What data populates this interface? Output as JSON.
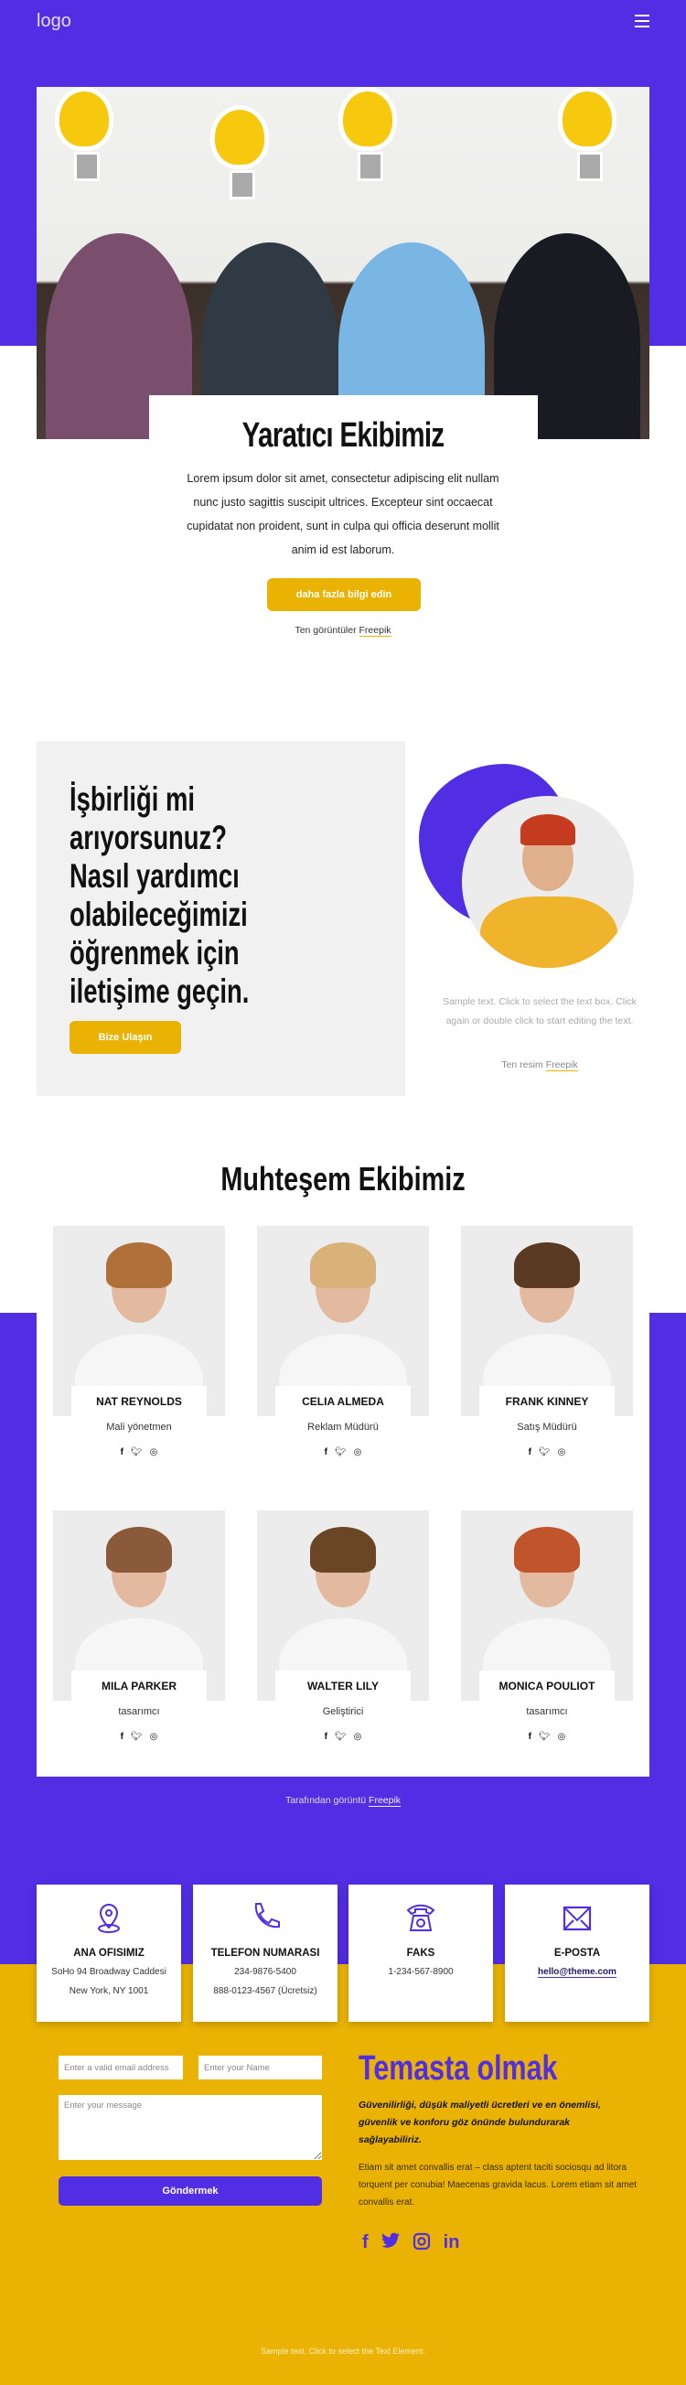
{
  "header": {
    "logo": "logo",
    "menu_icon": "hamburger-icon"
  },
  "hero": {
    "title": "Yaratıcı Ekibimiz",
    "text": "Lorem ipsum dolor sit amet, consectetur adipiscing elit nullam nunc justo sagittis suscipit ultrices. Excepteur sint occaecat cupidatat non proident, sunt in culpa qui officia deserunt mollit anim id est laborum.",
    "button": "daha fazla bilgi edin",
    "credit_prefix": "Ten görüntüler",
    "credit_link": "Freepik"
  },
  "collab": {
    "title": "İşbirliği mi\narıyorsunuz?\nNasıl yardımcı\nolabileceğimizi\nöğrenmek için\niletişime geçin.",
    "button": "Bize Ulaşın",
    "sample": "Sample text. Click to select the text box. Click again or double click to start editing the text.",
    "credit_prefix": "Ten resim",
    "credit_link": "Freepik"
  },
  "team": {
    "title": "Muhteşem Ekibimiz",
    "members": [
      {
        "name": "NAT REYNOLDS",
        "role": "Mali yönetmen"
      },
      {
        "name": "CELIA ALMEDA",
        "role": "Reklam Müdürü"
      },
      {
        "name": "FRANK KINNEY",
        "role": "Satış Müdürü"
      },
      {
        "name": "MILA PARKER",
        "role": "tasarımcı"
      },
      {
        "name": "WALTER LILY",
        "role": "Geliştirici"
      },
      {
        "name": "MONICA POULIOT",
        "role": "tasarımcı"
      }
    ],
    "social": [
      "f",
      "𝕥",
      "◎"
    ],
    "credit_prefix": "Tarafından görüntü",
    "credit_link": "Freepik"
  },
  "contact_info": [
    {
      "icon": "map-pin-icon",
      "title": "ANA OFISIMIZ",
      "lines": [
        "SoHo 94 Broadway Caddesi",
        "New York, NY 1001"
      ]
    },
    {
      "icon": "phone-icon",
      "title": "TELEFON NUMARASI",
      "lines": [
        "234-9876-5400",
        "888-0123-4567 (Ücretsiz)"
      ]
    },
    {
      "icon": "telephone-icon",
      "title": "FAKS",
      "lines": [
        "1-234-567-8900"
      ]
    },
    {
      "icon": "envelope-icon",
      "title": "E-POSTA",
      "lines": [
        "hello@theme.com"
      ]
    }
  ],
  "form": {
    "email_placeholder": "Enter a valid email address",
    "name_placeholder": "Enter your Name",
    "message_placeholder": "Enter your message",
    "submit": "Göndermek"
  },
  "get_in_touch": {
    "title": "Temasta olmak",
    "subtitle": "Güvenilirliği, düşük maliyetli ücretleri ve en önemlisi, güvenlik ve konforu göz önünde bulundurarak sağlayabiliriz.",
    "body": "Etiam sit amet convallis erat – class aptent taciti sociosqu ad litora torquent per conubia! Maecenas gravida lacus. Lorem etiam sit amet convallis erat.",
    "social": [
      "f",
      "🐦",
      "◎",
      "in"
    ]
  },
  "footer": {
    "text": "Sample text. Click to select the Text Element."
  },
  "colors": {
    "purple": "#512de4",
    "yellow": "#eab303"
  }
}
